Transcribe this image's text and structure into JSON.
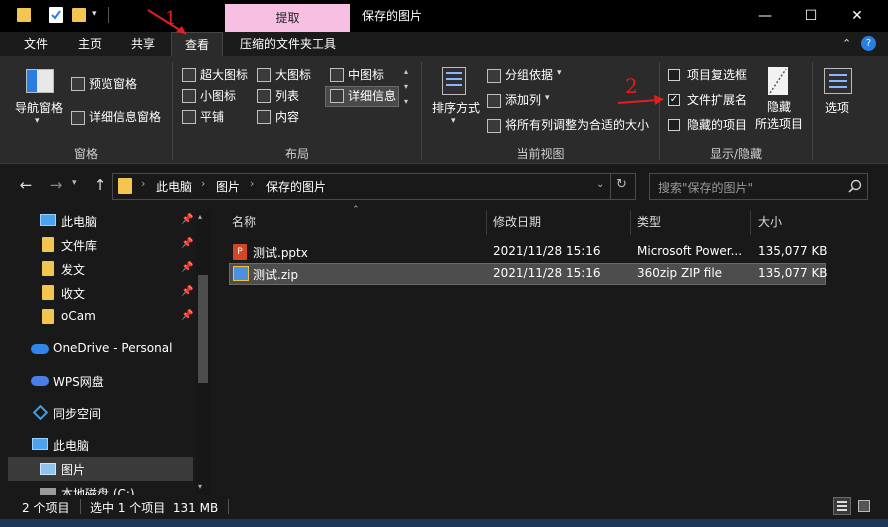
{
  "window": {
    "title": "保存的图片",
    "context_tab": "提取",
    "controls": {
      "minimize": "—",
      "maximize": "☐",
      "close": "✕"
    }
  },
  "ribbon_tabs": [
    "文件",
    "主页",
    "共享",
    "查看",
    "压缩的文件夹工具"
  ],
  "ribbon": {
    "panes": {
      "label": "窗格",
      "nav_pane": "导航窗格",
      "preview_pane": "预览窗格",
      "details_pane": "详细信息窗格"
    },
    "layout": {
      "label": "布局",
      "items": [
        [
          "超大图标",
          "大图标",
          "中图标"
        ],
        [
          "小图标",
          "列表",
          "详细信息"
        ],
        [
          "平铺",
          "内容"
        ]
      ]
    },
    "current_view": {
      "label": "当前视图",
      "sort_by": "排序方式",
      "group_by": "分组依据",
      "add_column": "添加列",
      "fit_columns": "将所有列调整为合适的大小"
    },
    "show_hide": {
      "label": "显示/隐藏",
      "item_checkboxes": "项目复选框",
      "item_checkboxes_checked": false,
      "file_extensions": "文件扩展名",
      "file_extensions_checked": true,
      "hidden_items": "隐藏的项目",
      "hidden_items_checked": false,
      "hide_selected": "隐藏\n所选项目"
    },
    "options": "选项"
  },
  "address": {
    "crumbs": [
      "此电脑",
      "图片",
      "保存的图片"
    ],
    "search_placeholder": "搜索\"保存的图片\""
  },
  "nav": {
    "items": [
      {
        "label": "此电脑",
        "pinned": true
      },
      {
        "label": "文件库",
        "pinned": true
      },
      {
        "label": "发文",
        "pinned": true
      },
      {
        "label": "收文",
        "pinned": true
      },
      {
        "label": "oCam",
        "pinned": true
      },
      {
        "label": "OneDrive - Personal"
      },
      {
        "label": "WPS网盘"
      },
      {
        "label": "同步空间"
      },
      {
        "label": "此电脑"
      },
      {
        "label": "图片"
      },
      {
        "label": "本地磁盘 (C:)"
      }
    ]
  },
  "files": {
    "columns": [
      "名称",
      "修改日期",
      "类型",
      "大小"
    ],
    "rows": [
      {
        "name": "测试.pptx",
        "date": "2021/11/28 15:16",
        "type": "Microsoft Power...",
        "size": "135,077 KB"
      },
      {
        "name": "测试.zip",
        "date": "2021/11/28 15:16",
        "type": "360zip ZIP file",
        "size": "135,077 KB"
      }
    ]
  },
  "status": {
    "count": "2 个项目",
    "selection": "选中 1 个项目  131 MB"
  },
  "annotations": {
    "step1": "1",
    "step2": "2"
  },
  "colors": {
    "accent_pink": "#f7c0e3",
    "folder_yellow": "#f3c652",
    "annotation_red": "#e02020"
  }
}
